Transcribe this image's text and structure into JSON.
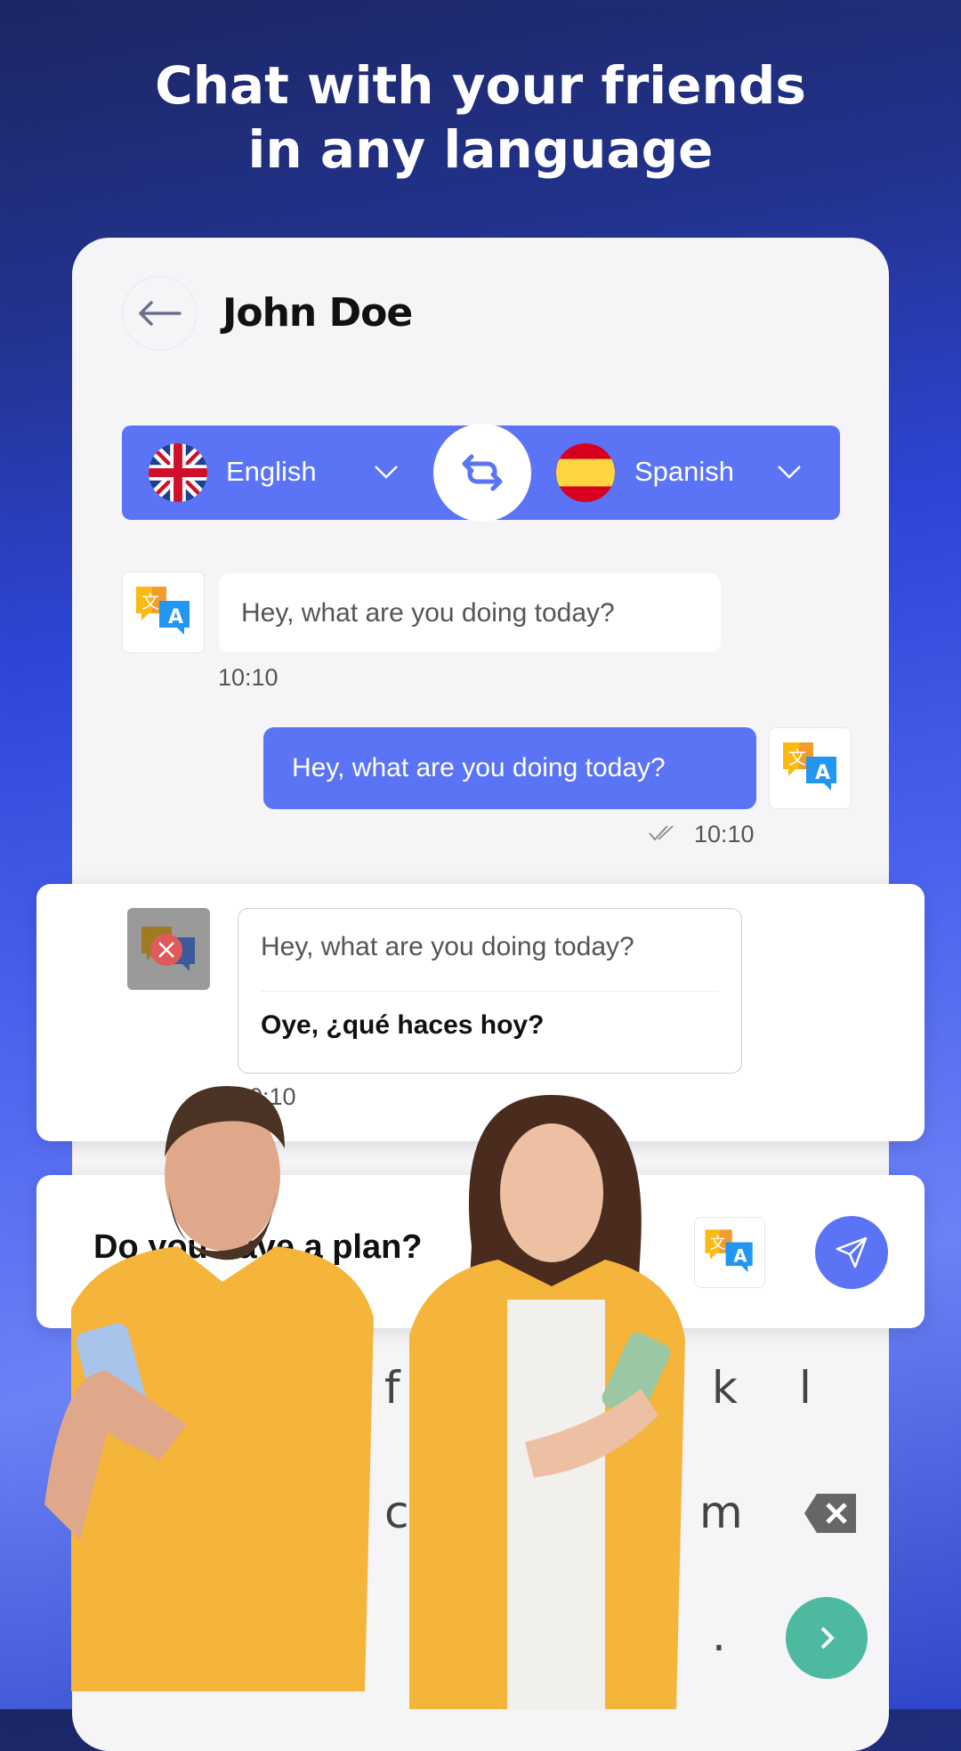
{
  "headline": {
    "line1": "Chat with your friends",
    "line2": "in any language"
  },
  "chat_header": {
    "contact_name": "John Doe",
    "back_icon": "arrow-left-icon"
  },
  "language_bar": {
    "source": {
      "label": "English",
      "flag": "uk-flag-icon"
    },
    "target": {
      "label": "Spanish",
      "flag": "spain-flag-icon"
    },
    "swap_icon": "swap-icon",
    "color": "#5b73f5"
  },
  "messages": [
    {
      "text": "Hey, what are you doing today?",
      "time": "10:10",
      "direction": "incoming"
    },
    {
      "text": "Hey, what are you doing today?",
      "time": "10:10",
      "direction": "outgoing",
      "status": "read-check-icon"
    }
  ],
  "translation_card": {
    "original": "Hey, what are you doing today?",
    "translated": "Oye, ¿qué haces hoy?",
    "time": "10:10"
  },
  "composer": {
    "value": "Do you have a plan?",
    "send_icon": "send-icon",
    "translate_icon": "translate-icon"
  },
  "keyboard": {
    "keys": [
      "f",
      "k",
      "l",
      "c",
      "m",
      "."
    ],
    "backspace_icon": "backspace-icon",
    "enter_icon": "chevron-right-icon"
  }
}
